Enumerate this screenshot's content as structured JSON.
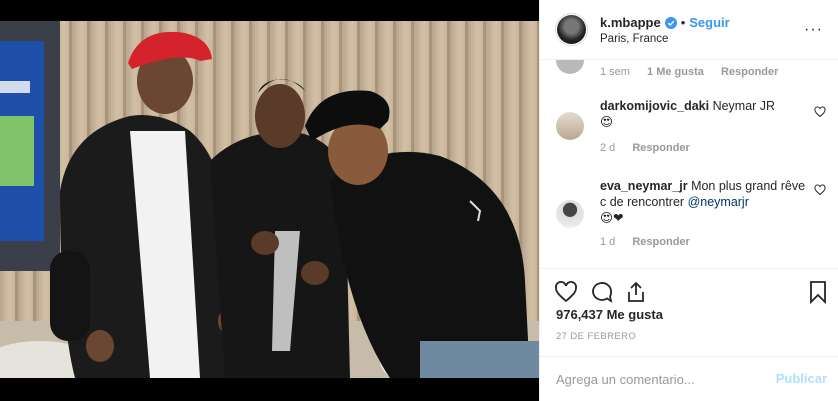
{
  "header": {
    "username": "k.mbappe",
    "separator": "•",
    "follow_label": "Seguir",
    "location": "Paris, France",
    "more_icon": "more-horizontal-icon"
  },
  "comments": [
    {
      "partial": true,
      "time": "1 sem",
      "likes": "1 Me gusta",
      "reply_label": "Responder"
    },
    {
      "user": "darkomijovic_daki",
      "text": "Neymar JR",
      "emoji": "😍",
      "time": "2 d",
      "reply_label": "Responder"
    },
    {
      "user": "eva_neymar_jr",
      "text": "Mon plus grand rêve c de rencontrer",
      "mention": "@neymarjr",
      "emoji": "😍❤",
      "time": "1 d",
      "reply_label": "Responder"
    }
  ],
  "actions": {
    "like_icon": "heart-icon",
    "comment_icon": "comment-bubble-icon",
    "share_icon": "share-icon",
    "save_icon": "bookmark-icon"
  },
  "likes_text": "976,437 Me gusta",
  "date_text": "27 DE FEBRERO",
  "add_comment": {
    "placeholder": "Agrega un comentario...",
    "post_label": "Publicar"
  },
  "colors": {
    "link_blue": "#3897f0",
    "post_disabled": "#b2dffc",
    "meta_gray": "#999999"
  }
}
